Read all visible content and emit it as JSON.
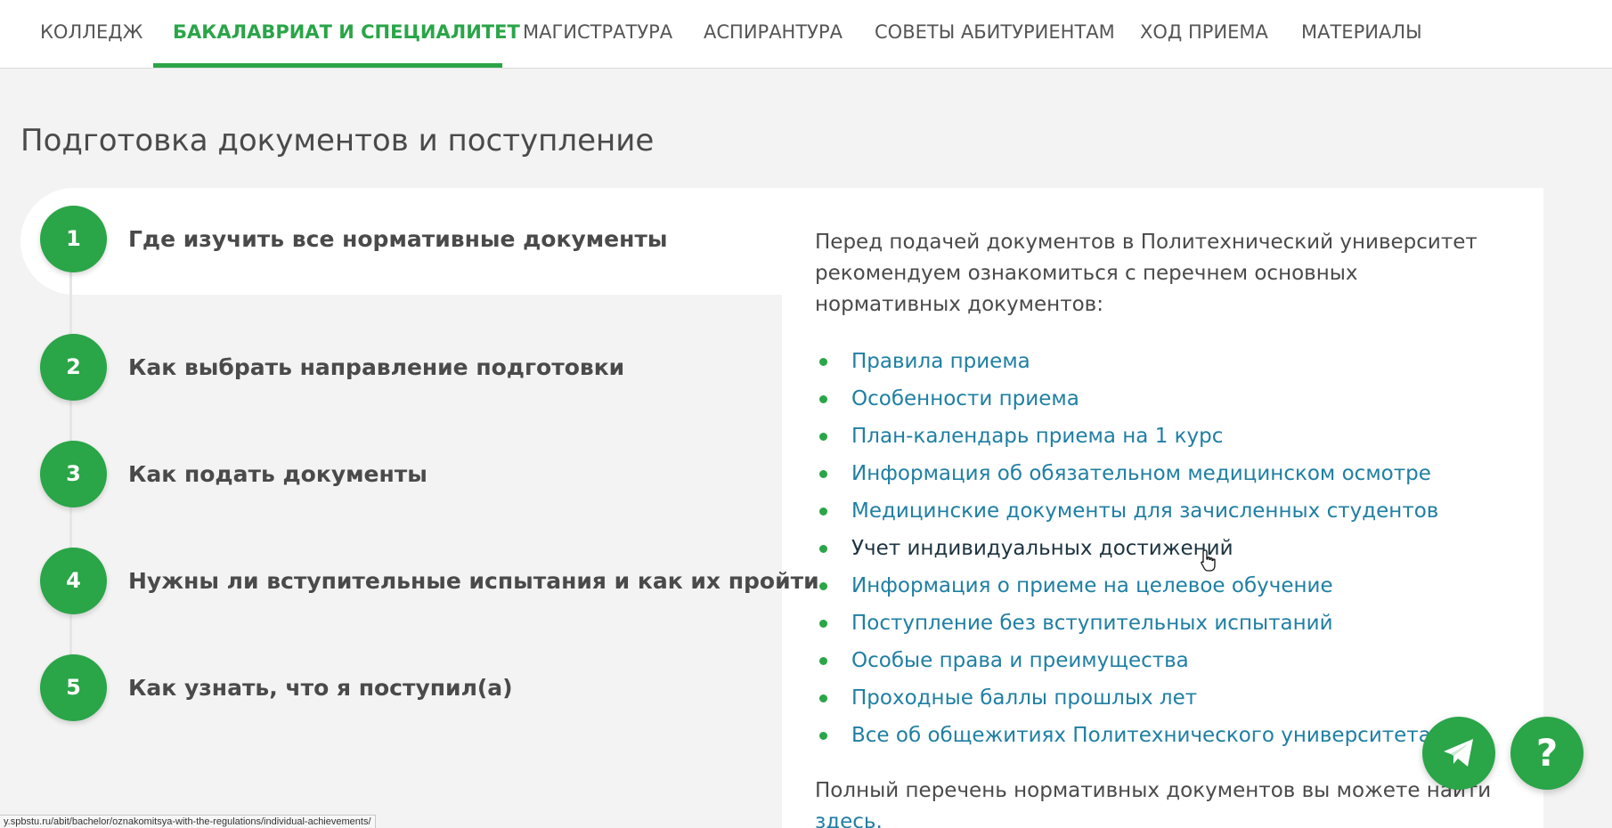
{
  "nav": {
    "tabs": [
      {
        "label": "КОЛЛЕДЖ"
      },
      {
        "label": "БАКАЛАВРИАТ И СПЕЦИАЛИТЕТ",
        "active": true
      },
      {
        "label": "МАГИСТРАТУРА"
      },
      {
        "label": "АСПИРАНТУРА"
      },
      {
        "label": "СОВЕТЫ АБИТУРИЕНТАМ"
      },
      {
        "label": "ХОД ПРИЕМА"
      },
      {
        "label": "МАТЕРИАЛЫ"
      }
    ]
  },
  "page": {
    "title": "Подготовка документов и поступление"
  },
  "steps": [
    {
      "number": "1",
      "label": "Где изучить все нормативные документы",
      "active": true
    },
    {
      "number": "2",
      "label": "Как выбрать направление подготовки"
    },
    {
      "number": "3",
      "label": "Как подать документы"
    },
    {
      "number": "4",
      "label": "Нужны ли вступительные испытания и как их пройти"
    },
    {
      "number": "5",
      "label": "Как узнать, что я поступил(а)"
    }
  ],
  "content": {
    "intro": "Перед подачей документов в Политехнический университет рекомендуем ознакомиться с перечнем основных нормативных документов:",
    "links": [
      {
        "label": "Правила приема"
      },
      {
        "label": "Особенности приема"
      },
      {
        "label": "План-календарь приема на 1 курс"
      },
      {
        "label": "Информация об обязательном медицинском осмотре"
      },
      {
        "label": "Медицинские документы для зачисленных студентов"
      },
      {
        "label": "Учет индивидуальных достижений",
        "hovered": true
      },
      {
        "label": "Информация о приеме на целевое обучение"
      },
      {
        "label": "Поступление без вступительных испытаний"
      },
      {
        "label": "Особые права и преимущества"
      },
      {
        "label": "Проходные баллы прошлых лет"
      },
      {
        "label": "Все об общежитиях Политехнического университета"
      }
    ],
    "full_list_text": "Полный перечень нормативных документов вы можете найти",
    "full_list_link": "здесь."
  },
  "fabs": {
    "telegram_icon": "telegram-icon",
    "help_label": "?"
  },
  "status_bar": {
    "url": "y.spbstu.ru/abit/bachelor/oznakomitsya-with-the-regulations/individual-achievements/"
  },
  "colors": {
    "accent": "#2aa548",
    "link": "#1f7fa3",
    "link_hover": "#1d3440",
    "text": "#4a4a4a",
    "background": "#f3f3f3"
  }
}
